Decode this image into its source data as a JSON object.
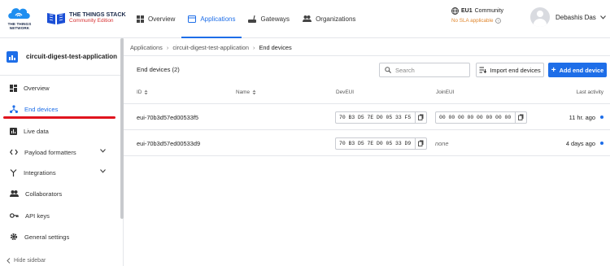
{
  "header": {
    "ttn_logo_text": "THE THINGS NETWORK",
    "product_name": "THE THINGS STACK",
    "edition": "Community Edition",
    "nav": [
      {
        "label": "Overview",
        "icon": "grid-icon"
      },
      {
        "label": "Applications",
        "icon": "window-icon",
        "active": true
      },
      {
        "label": "Gateways",
        "icon": "gateway-icon"
      },
      {
        "label": "Organizations",
        "icon": "people-icon"
      }
    ],
    "cluster": {
      "region": "EU1",
      "label": "Community",
      "sla": "No SLA applicable"
    },
    "user": {
      "name": "Debashis Das"
    }
  },
  "sidebar": {
    "app_name": "circuit-digest-test-application",
    "items": [
      {
        "label": "Overview"
      },
      {
        "label": "End devices",
        "active": true
      },
      {
        "label": "Live data"
      },
      {
        "label": "Payload formatters",
        "expandable": true
      },
      {
        "label": "Integrations",
        "expandable": true
      },
      {
        "label": "Collaborators"
      },
      {
        "label": "API keys"
      },
      {
        "label": "General settings"
      }
    ],
    "hide_label": "Hide sidebar"
  },
  "breadcrumb": [
    "Applications",
    "circuit-digest-test-application",
    "End devices"
  ],
  "table": {
    "title": "End devices (2)",
    "search_placeholder": "Search",
    "import_label": "Import end devices",
    "add_label": "Add end device",
    "columns": [
      "ID",
      "Name",
      "DevEUI",
      "JoinEUI",
      "Last activity"
    ],
    "rows": [
      {
        "id": "eui-70b3d57ed00533f5",
        "name": "",
        "dev_eui": "70 B3 D5 7E D0 05 33 F5",
        "join_eui": "00 00 00 00 00 00 00 00",
        "last_activity": "11 hr. ago"
      },
      {
        "id": "eui-70b3d57ed00533d9",
        "name": "",
        "dev_eui": "70 B3 D5 7E D0 05 33 D9",
        "join_eui": "none",
        "last_activity": "4 days ago"
      }
    ]
  },
  "colors": {
    "accent": "#1e6ee8",
    "highlight": "#e0141e",
    "warning": "#e0862d"
  }
}
